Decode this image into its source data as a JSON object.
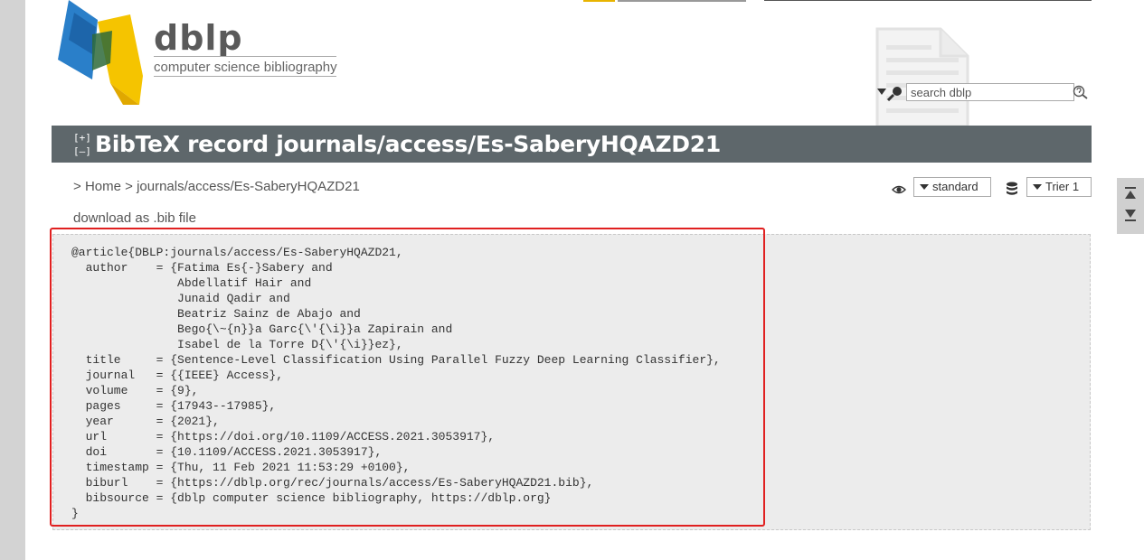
{
  "logo": {
    "word": "dblp",
    "subtitle": "computer science bibliography"
  },
  "search": {
    "placeholder": "search dblp"
  },
  "page": {
    "toggle_expand": "[+]",
    "toggle_collapse": "[–]",
    "title": "BibTeX record journals/access/Es-SaberyHQAZD21"
  },
  "breadcrumb": {
    "sep1": "> ",
    "home": "Home",
    "sep2": " > ",
    "current": "journals/access/Es-SaberyHQAZD21"
  },
  "download_label": "download as .bib file",
  "controls": {
    "view_selected": "standard",
    "server_selected": "Trier 1"
  },
  "bibtex": "@article{DBLP:journals/access/Es-SaberyHQAZD21,\n  author    = {Fatima Es{-}Sabery and\n               Abdellatif Hair and\n               Junaid Qadir and\n               Beatriz Sainz de Abajo and\n               Bego{\\~{n}}a Garc{\\'{\\i}}a Zapirain and\n               Isabel de la Torre D{\\'{\\i}}ez},\n  title     = {Sentence-Level Classification Using Parallel Fuzzy Deep Learning Classifier},\n  journal   = {{IEEE} Access},\n  volume    = {9},\n  pages     = {17943--17985},\n  year      = {2021},\n  url       = {https://doi.org/10.1109/ACCESS.2021.3053917},\n  doi       = {10.1109/ACCESS.2021.3053917},\n  timestamp = {Thu, 11 Feb 2021 11:53:29 +0100},\n  biburl    = {https://dblp.org/rec/journals/access/Es-SaberyHQAZD21.bib},\n  bibsource = {dblp computer science bibliography, https://dblp.org}\n}",
  "colors": {
    "title_bar": "#5e676b",
    "highlight": "#e02020",
    "logo_blue": "#2a7fc9",
    "logo_yellow": "#f5c400"
  }
}
